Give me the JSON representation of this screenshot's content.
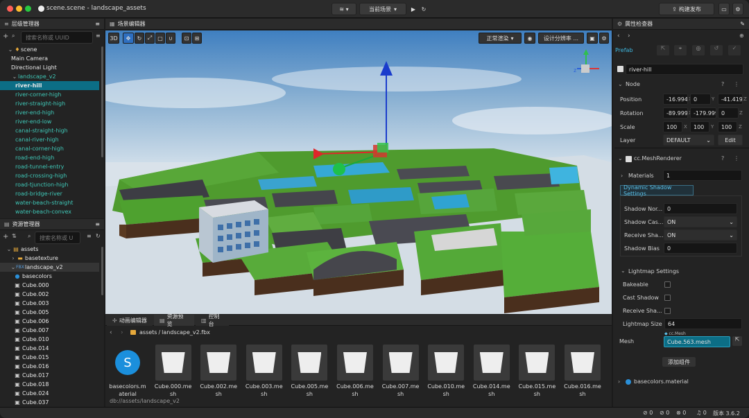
{
  "window": {
    "title": "scene.scene - landscape_assets"
  },
  "toolbar": {
    "scene_select": "当前场景",
    "publish": "构建发布"
  },
  "hierarchy": {
    "title": "层级管理器",
    "search_placeholder": "搜索名称或 UUID",
    "items": [
      "scene",
      "Main Camera",
      "Directional Light",
      "landscape_v2",
      "river-hill",
      "river-corner-high",
      "river-straight-high",
      "river-end-high",
      "river-end-low",
      "canal-straight-high",
      "canal-river-high",
      "canal-corner-high",
      "road-end-high",
      "road-tunnel-entry",
      "road-crossing-high",
      "road-tjunction-high",
      "road-bridge-river",
      "water-beach-straight",
      "water-beach-convex"
    ]
  },
  "assets": {
    "title": "资源管理器",
    "search_placeholder": "搜索名称或 U",
    "items": [
      "assets",
      "basetexture",
      "landscape_v2",
      "basecolors",
      "Cube.000",
      "Cube.002",
      "Cube.003",
      "Cube.005",
      "Cube.006",
      "Cube.007",
      "Cube.010",
      "Cube.014",
      "Cube.015",
      "Cube.016",
      "Cube.017",
      "Cube.018",
      "Cube.024",
      "Cube.037"
    ]
  },
  "scene_editor": {
    "title": "场景编辑器",
    "btn_3d": "3D",
    "render_mode": "正常渲染",
    "resolution": "设计分辨率 ..."
  },
  "bottom": {
    "tabs": [
      "动画编辑器",
      "资源预览",
      "控制台"
    ],
    "path_root": "assets",
    "path_sep": "/",
    "path_file": "landscape_v2.fbx",
    "footer_path": "db://assets/landscape_v2",
    "assets": [
      "basecolors.material",
      "Cube.000.mesh",
      "Cube.002.mesh",
      "Cube.003.mesh",
      "Cube.005.mesh",
      "Cube.006.mesh",
      "Cube.007.mesh",
      "Cube.010.mesh",
      "Cube.014.mesh",
      "Cube.015.mesh",
      "Cube.016.mesh"
    ]
  },
  "inspector": {
    "title": "属性检查器",
    "prefab": "Prefab",
    "node_name": "river-hill",
    "node_section": "Node",
    "position_label": "Position",
    "position": [
      "-16.994",
      "0",
      "-41.4193"
    ],
    "rotation_label": "Rotation",
    "rotation": [
      "-89.9999",
      "-179.999",
      "0"
    ],
    "scale_label": "Scale",
    "scale": [
      "100",
      "100",
      "100"
    ],
    "layer_label": "Layer",
    "layer": "DEFAULT",
    "edit": "Edit",
    "axes": [
      "X",
      "Y",
      "Z"
    ],
    "mesh_renderer": "cc.MeshRenderer",
    "materials_label": "Materials",
    "materials": "1",
    "dyn_shadow": "Dynamic Shadow Settings",
    "shadow_normal_label": "Shadow Nor...",
    "shadow_normal": "0",
    "shadow_cast_label": "Shadow Cas...",
    "shadow_cast": "ON",
    "receive_shadow_label": "Receive Sha...",
    "receive_shadow": "ON",
    "shadow_bias_label": "Shadow Bias",
    "shadow_bias": "0",
    "lightmap_section": "Lightmap Settings",
    "bakeable": "Bakeable",
    "cast_shadow": "Cast Shadow",
    "receive_shadow2": "Receive Sha...",
    "lightmap_size_label": "Lightmap Size",
    "lightmap_size": "64",
    "mesh_label": "Mesh",
    "mesh_type": "cc.Mesh",
    "mesh": "Cube.563.mesh",
    "add_component": "添加组件",
    "material_item": "basecolors.material"
  },
  "status": {
    "errors": "0",
    "warnings": "0",
    "logs": "0",
    "notifications": "0",
    "version": "版本 3.6.2"
  }
}
